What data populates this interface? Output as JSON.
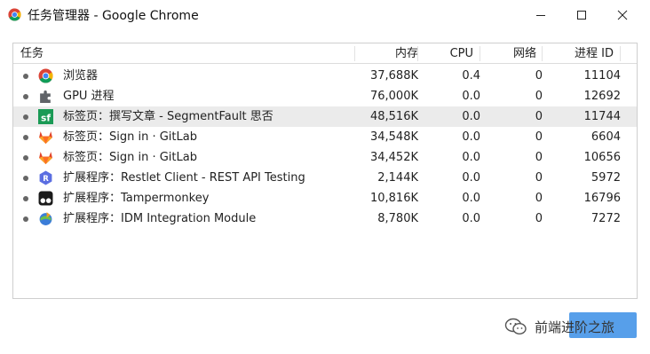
{
  "window": {
    "title": "任务管理器 - Google Chrome",
    "controls": [
      "minimize",
      "maximize",
      "close"
    ]
  },
  "table": {
    "columns": {
      "task": "任务",
      "memory": "内存",
      "cpu": "CPU",
      "network": "网络",
      "pid": "进程 ID"
    },
    "rows": [
      {
        "icon": "chrome-icon",
        "name": "浏览器",
        "memory": "37,688K",
        "cpu": "0.4",
        "network": "0",
        "pid": "11104",
        "selected": false
      },
      {
        "icon": "puzzle-icon",
        "name": "GPU 进程",
        "memory": "76,000K",
        "cpu": "0.0",
        "network": "0",
        "pid": "12692",
        "selected": false
      },
      {
        "icon": "segmentfault-icon",
        "name": "标签页：撰写文章 - SegmentFault 思否",
        "memory": "48,516K",
        "cpu": "0.0",
        "network": "0",
        "pid": "11744",
        "selected": true
      },
      {
        "icon": "gitlab-icon",
        "name": "标签页：Sign in · GitLab",
        "memory": "34,548K",
        "cpu": "0.0",
        "network": "0",
        "pid": "6604",
        "selected": false
      },
      {
        "icon": "gitlab-icon",
        "name": "标签页：Sign in · GitLab",
        "memory": "34,452K",
        "cpu": "0.0",
        "network": "0",
        "pid": "10656",
        "selected": false
      },
      {
        "icon": "restlet-icon",
        "name": "扩展程序：Restlet Client - REST API Testing",
        "memory": "2,144K",
        "cpu": "0.0",
        "network": "0",
        "pid": "5972",
        "selected": false
      },
      {
        "icon": "tampermonkey-icon",
        "name": "扩展程序：Tampermonkey",
        "memory": "10,816K",
        "cpu": "0.0",
        "network": "0",
        "pid": "16796",
        "selected": false
      },
      {
        "icon": "idm-icon",
        "name": "扩展程序：IDM Integration Module",
        "memory": "8,780K",
        "cpu": "0.0",
        "network": "0",
        "pid": "7272",
        "selected": false
      }
    ]
  },
  "watermark": {
    "text": "前端进阶之旅",
    "icon": "wechat-icon"
  },
  "colors": {
    "selected_row": "#ebebeb",
    "button_accent": "#3a8ee6"
  }
}
